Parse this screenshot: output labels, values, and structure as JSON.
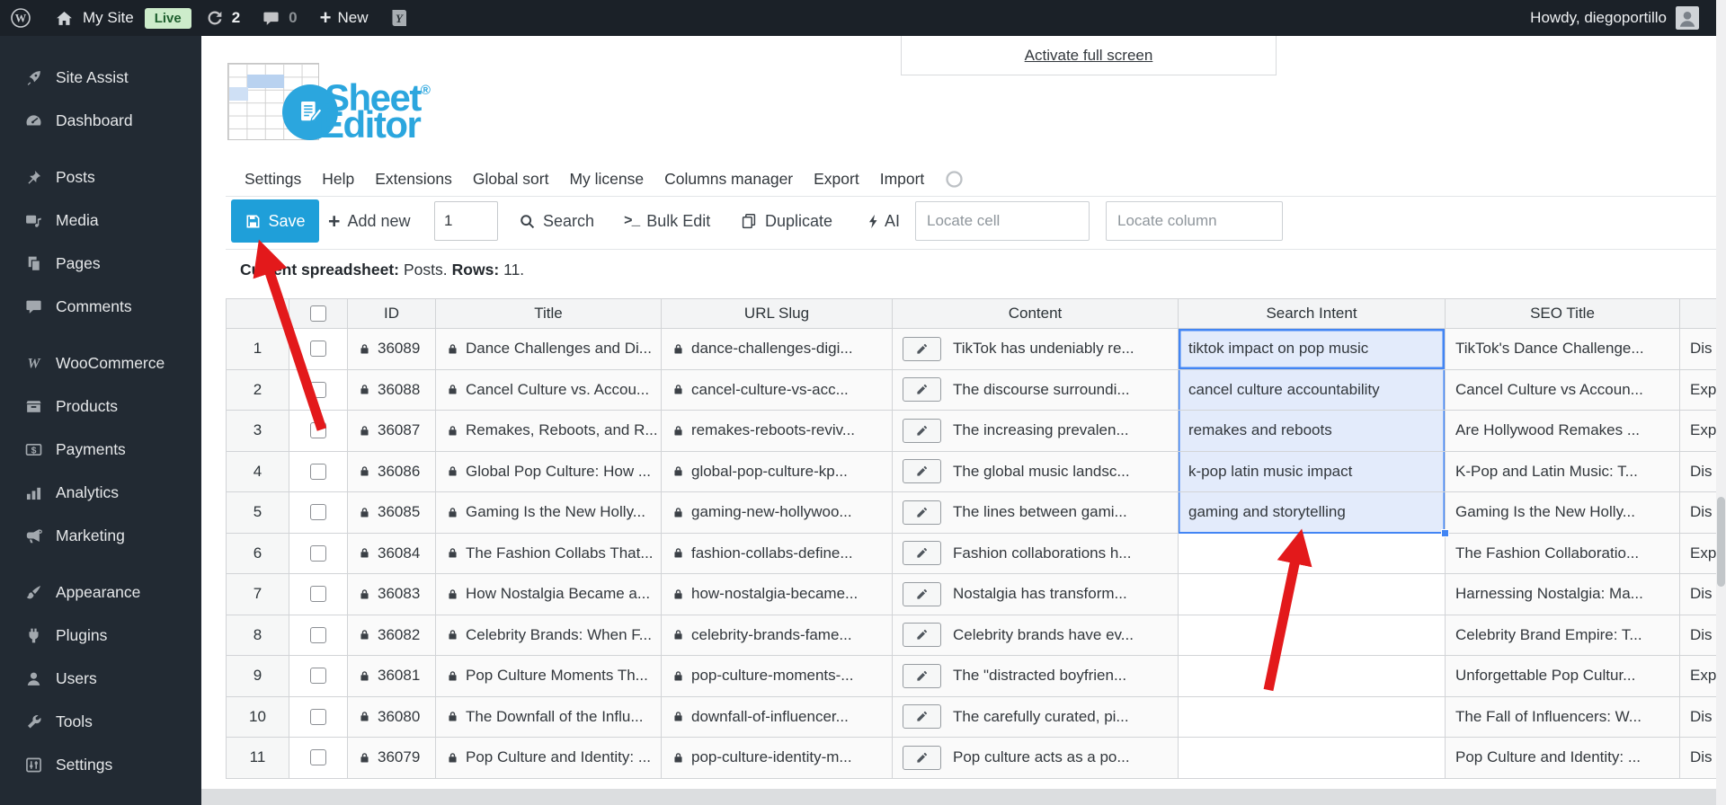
{
  "admin_bar": {
    "site_name": "My Site",
    "live_badge": "Live",
    "updates_count": "2",
    "comments_count": "0",
    "new_plus": "+",
    "new_label": "New",
    "howdy": "Howdy, diegoportillo"
  },
  "sidebar": {
    "items": [
      {
        "label": "Site Assist",
        "icon": "rocket-icon",
        "gap_before": false
      },
      {
        "label": "Dashboard",
        "icon": "dashboard-icon",
        "gap_before": false
      },
      {
        "label": "Posts",
        "icon": "pin-icon",
        "gap_before": true
      },
      {
        "label": "Media",
        "icon": "media-icon",
        "gap_before": false
      },
      {
        "label": "Pages",
        "icon": "pages-icon",
        "gap_before": false
      },
      {
        "label": "Comments",
        "icon": "comment-icon",
        "gap_before": false
      },
      {
        "label": "WooCommerce",
        "icon": "woocommerce-icon",
        "gap_before": true
      },
      {
        "label": "Products",
        "icon": "products-icon",
        "gap_before": false
      },
      {
        "label": "Payments",
        "icon": "payments-icon",
        "gap_before": false
      },
      {
        "label": "Analytics",
        "icon": "analytics-icon",
        "gap_before": false
      },
      {
        "label": "Marketing",
        "icon": "marketing-icon",
        "gap_before": false
      },
      {
        "label": "Appearance",
        "icon": "appearance-icon",
        "gap_before": true
      },
      {
        "label": "Plugins",
        "icon": "plugins-icon",
        "gap_before": false
      },
      {
        "label": "Users",
        "icon": "users-icon",
        "gap_before": false
      },
      {
        "label": "Tools",
        "icon": "tools-icon",
        "gap_before": false
      },
      {
        "label": "Settings",
        "icon": "settings-icon",
        "gap_before": false
      }
    ]
  },
  "header": {
    "fullscreen_link": "Activate full screen",
    "logo_sheet": "Sheet",
    "logo_reg": "®",
    "logo_editor": "Editor"
  },
  "menu": {
    "items": [
      "Settings",
      "Help",
      "Extensions",
      "Global sort",
      "My license",
      "Columns manager",
      "Export",
      "Import"
    ]
  },
  "toolbar": {
    "save_label": "Save",
    "add_plus": "+",
    "add_new_label": "Add new",
    "rows_input_value": "1",
    "search_label": "Search",
    "bulk_glyph": ">_",
    "bulk_edit_label": "Bulk Edit",
    "duplicate_label": "Duplicate",
    "ai_label": "AI",
    "locate_cell_placeholder": "Locate cell",
    "locate_column_placeholder": "Locate column"
  },
  "status": {
    "current_label": "Current spreadsheet:",
    "current_value": "Posts.",
    "rows_label": "Rows:",
    "rows_value": "11."
  },
  "table": {
    "columns": [
      "ID",
      "Title",
      "URL Slug",
      "Content",
      "Search Intent",
      "SEO Title",
      ""
    ],
    "selection": {
      "column": "Search Intent",
      "rows": [
        1,
        2,
        3,
        4,
        5
      ],
      "active_row": 1
    },
    "rows": [
      {
        "num": "1",
        "id": "36089",
        "title": "Dance Challenges and Di...",
        "slug": "dance-challenges-digi...",
        "content": "TikTok has undeniably re...",
        "search_intent": "tiktok impact on pop music",
        "seo_title": "TikTok's Dance Challenge...",
        "overflow": "Dis"
      },
      {
        "num": "2",
        "id": "36088",
        "title": "Cancel Culture vs. Accou...",
        "slug": "cancel-culture-vs-acc...",
        "content": "The discourse surroundi...",
        "search_intent": "cancel culture accountability",
        "seo_title": "Cancel Culture vs Accoun...",
        "overflow": "Exp"
      },
      {
        "num": "3",
        "id": "36087",
        "title": "Remakes, Reboots, and R...",
        "slug": "remakes-reboots-reviv...",
        "content": "The increasing prevalen...",
        "search_intent": "remakes and reboots",
        "seo_title": "Are Hollywood Remakes ...",
        "overflow": "Exp"
      },
      {
        "num": "4",
        "id": "36086",
        "title": "Global Pop Culture: How ...",
        "slug": "global-pop-culture-kp...",
        "content": "The global music landsc...",
        "search_intent": "k-pop latin music impact",
        "seo_title": "K-Pop and Latin Music: T...",
        "overflow": "Dis"
      },
      {
        "num": "5",
        "id": "36085",
        "title": "Gaming Is the New Holly...",
        "slug": "gaming-new-hollywoo...",
        "content": "The lines between gami...",
        "search_intent": "gaming and storytelling",
        "seo_title": "Gaming Is the New Holly...",
        "overflow": "Dis"
      },
      {
        "num": "6",
        "id": "36084",
        "title": "The Fashion Collabs That...",
        "slug": "fashion-collabs-define...",
        "content": "Fashion collaborations h...",
        "search_intent": "",
        "seo_title": "The Fashion Collaboratio...",
        "overflow": "Exp"
      },
      {
        "num": "7",
        "id": "36083",
        "title": "How Nostalgia Became a...",
        "slug": "how-nostalgia-became...",
        "content": "Nostalgia has transform...",
        "search_intent": "",
        "seo_title": "Harnessing Nostalgia: Ma...",
        "overflow": "Dis"
      },
      {
        "num": "8",
        "id": "36082",
        "title": "Celebrity Brands: When F...",
        "slug": "celebrity-brands-fame...",
        "content": "Celebrity brands have ev...",
        "search_intent": "",
        "seo_title": "Celebrity Brand Empire: T...",
        "overflow": "Dis"
      },
      {
        "num": "9",
        "id": "36081",
        "title": "Pop Culture Moments Th...",
        "slug": "pop-culture-moments-...",
        "content": "The \"distracted boyfrien...",
        "search_intent": "",
        "seo_title": "Unforgettable Pop Cultur...",
        "overflow": "Exp"
      },
      {
        "num": "10",
        "id": "36080",
        "title": "The Downfall of the Influ...",
        "slug": "downfall-of-influencer...",
        "content": "The carefully curated, pi...",
        "search_intent": "",
        "seo_title": "The Fall of Influencers: W...",
        "overflow": "Dis"
      },
      {
        "num": "11",
        "id": "36079",
        "title": "Pop Culture and Identity: ...",
        "slug": "pop-culture-identity-m...",
        "content": "Pop culture acts as a po...",
        "search_intent": "",
        "seo_title": "Pop Culture and Identity: ...",
        "overflow": "Dis"
      }
    ]
  },
  "colors": {
    "accent_blue": "#1f9fd9",
    "logo_blue": "#2ba6de",
    "selection_border": "#4285f4",
    "selection_bg": "#e3ebfb",
    "arrow_red": "#e3191b",
    "live_badge_bg": "#cdeccb",
    "live_badge_text": "#1e5f2e"
  }
}
